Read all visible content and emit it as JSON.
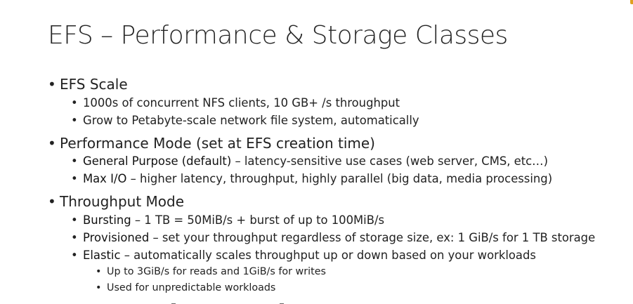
{
  "slide": {
    "title": "EFS – Performance & Storage Classes",
    "bullet_char": "•",
    "sections": [
      {
        "heading": "EFS Scale",
        "items": [
          {
            "text": "1000s of concurrent NFS clients, 10 GB+ /s throughput"
          },
          {
            "text": "Grow to Petabyte-scale network file system, automatically"
          }
        ]
      },
      {
        "heading": "Performance Mode (set at EFS creation time)",
        "items": [
          {
            "term": "General Purpose (default)",
            "text": " – latency-sensitive use cases (web server, CMS, etc…)"
          },
          {
            "term": "Max I/O",
            "text": " – higher latency, throughput, highly parallel (big data, media processing)"
          }
        ]
      },
      {
        "heading": "Throughput Mode",
        "items": [
          {
            "term": "Bursting",
            "text": " – 1 TB = 50MiB/s + burst of up to 100MiB/s"
          },
          {
            "term": "Provisioned",
            "text": " – set your throughput regardless of storage size, ex: 1 GiB/s for 1 TB storage"
          },
          {
            "term": "Elastic",
            "text": " – automatically scales throughput up or down based on your workloads"
          }
        ],
        "subitems": [
          {
            "text": "Up to 3GiB/s for reads and 1GiB/s for writes"
          },
          {
            "text": "Used for unpredictable workloads"
          }
        ]
      }
    ]
  }
}
